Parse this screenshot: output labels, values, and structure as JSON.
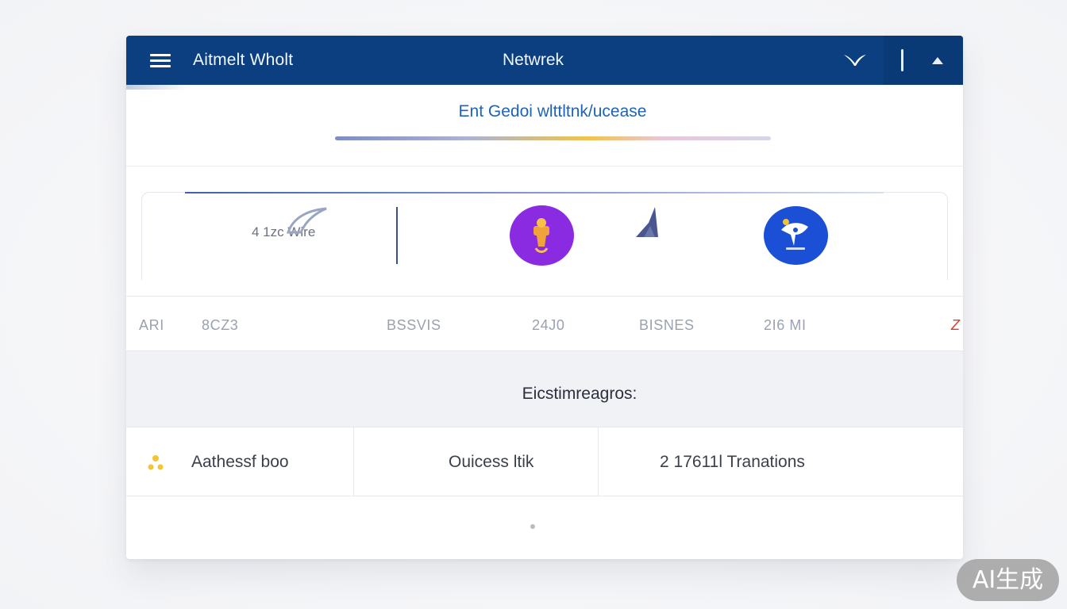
{
  "header": {
    "app_title": "Aitmelt  Wholt",
    "network_title": "Netwrek",
    "icons": [
      "menu-icon",
      "bird-icon",
      "bar-icon",
      "caret-up-icon"
    ]
  },
  "subtitle": {
    "text": "Ent Gedoi wlttltnk/ucease",
    "progress_colors": [
      "#7f8bc6",
      "#f2c24e",
      "#e9c6d6"
    ]
  },
  "assets": {
    "label": "4 1zc  Wire",
    "icons": [
      "swoosh-icon",
      "purple-coin-icon",
      "mountain-icon",
      "blue-coin-icon"
    ]
  },
  "ticker": {
    "items": [
      "ARI",
      "8CZ3",
      "BSSVIS",
      "24J0",
      "BISNES",
      "2I6 MI"
    ],
    "end_glyph": "Z"
  },
  "band": {
    "title": "Eicstimreagros:"
  },
  "info_row": {
    "cell_a": "Aathessf boo",
    "cell_b": "Ouicess ltik",
    "cell_c": "2  17611l Tranations"
  },
  "watermark": "AI生成",
  "colors": {
    "header_bg": "#0b3f7f",
    "accent_blue": "#1f63b8",
    "coin_purple": "#8a2be2",
    "coin_blue": "#1a4fd6",
    "ticker_end": "#d9432c"
  }
}
